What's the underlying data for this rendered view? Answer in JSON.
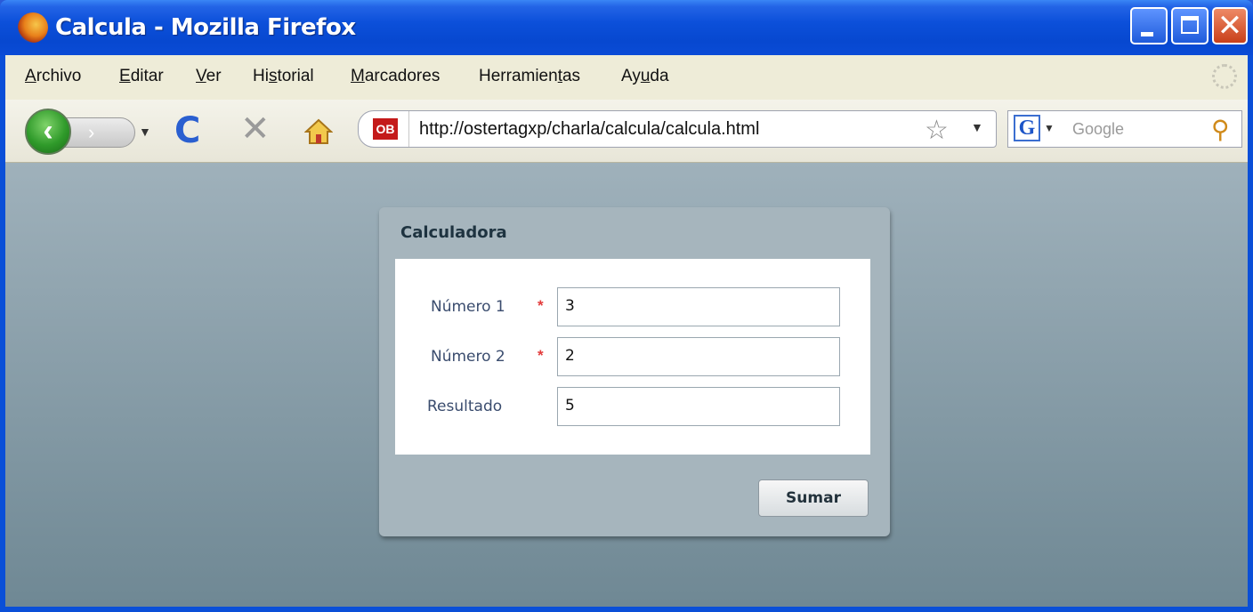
{
  "window": {
    "title": "Calcula - Mozilla Firefox"
  },
  "menubar": {
    "items": [
      {
        "pre": "",
        "key": "A",
        "post": "rchivo"
      },
      {
        "pre": "",
        "key": "E",
        "post": "ditar"
      },
      {
        "pre": "",
        "key": "V",
        "post": "er"
      },
      {
        "pre": "Hi",
        "key": "s",
        "post": "torial"
      },
      {
        "pre": "",
        "key": "M",
        "post": "arcadores"
      },
      {
        "pre": "Herramien",
        "key": "t",
        "post": "as"
      },
      {
        "pre": "Ay",
        "key": "u",
        "post": "da"
      }
    ]
  },
  "navbar": {
    "site_icon_label": "OB",
    "url": "http://ostertagxp/charla/calcula/calcula.html",
    "search_engine_letter": "G",
    "search_placeholder": "Google"
  },
  "icons": {
    "back": "back-arrow-icon",
    "forward": "forward-arrow-icon",
    "reload": "reload-icon",
    "stop": "stop-icon",
    "home": "home-icon",
    "bookmark": "star-icon",
    "search": "magnifier-icon"
  },
  "form": {
    "title": "Calculadora",
    "fields": [
      {
        "label": "Número 1",
        "required": true,
        "value": "3"
      },
      {
        "label": "Número 2",
        "required": true,
        "value": "2"
      },
      {
        "label": "Resultado",
        "required": false,
        "value": "5"
      }
    ],
    "required_mark": "*",
    "submit_label": "Sumar"
  },
  "colors": {
    "titlebar": "#0a4fd8",
    "content_bg": "#8ea2ad",
    "required": "#e23b3b"
  }
}
